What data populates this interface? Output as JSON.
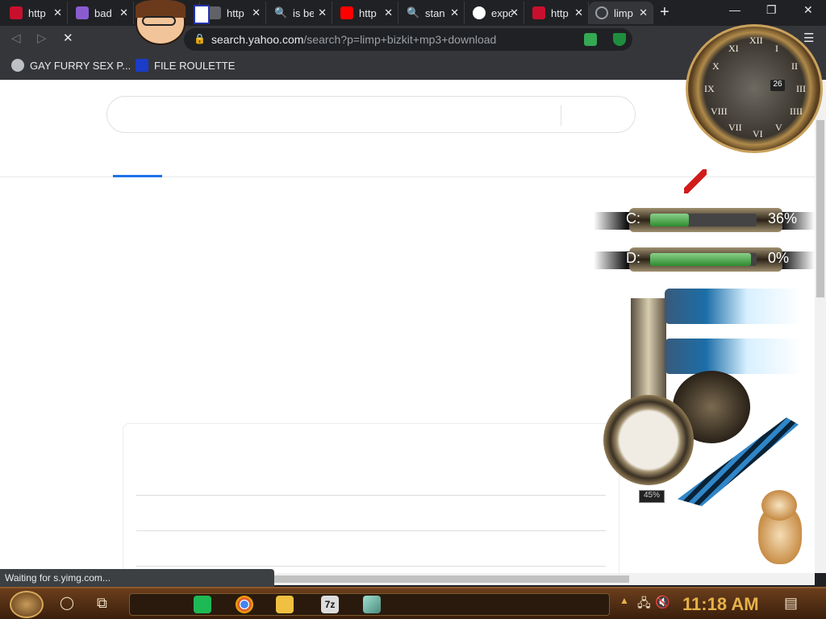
{
  "tabs": [
    {
      "label": "http",
      "icon": "ask-icon",
      "color": "#c8102e"
    },
    {
      "label": "bad",
      "icon": "paintbrush-icon",
      "color": "#8a5cd0"
    },
    {
      "label": "",
      "icon": "ask-icon",
      "color": "#c8102e"
    },
    {
      "label": "http",
      "icon": "generic-icon",
      "color": "#5f6368"
    },
    {
      "label": "is be",
      "icon": "search-icon",
      "color": "#4a90e2"
    },
    {
      "label": "http",
      "icon": "youtube-icon",
      "color": "#ff0000"
    },
    {
      "label": "stan",
      "icon": "search-icon",
      "color": "#4a90e2"
    },
    {
      "label": "expo",
      "icon": "google-icon",
      "color": "#ffffff"
    },
    {
      "label": "http",
      "icon": "ask-icon",
      "color": "#c8102e"
    },
    {
      "label": "limp",
      "icon": "loading-icon",
      "color": "#9aa0a6"
    }
  ],
  "address_bar": {
    "domain": "search.yahoo.com",
    "path": "/search?p=limp+bizkit+mp3+download"
  },
  "bookmarks": [
    {
      "label": "GAY FURRY SEX P...",
      "icon": "globe-icon"
    },
    {
      "label": "FILE ROULETTE",
      "icon": "mf-icon"
    }
  ],
  "status_text": "Waiting for s.yimg.com...",
  "drives": [
    {
      "label": "C:",
      "percent_text": "36%",
      "fill": 0.36
    },
    {
      "label": "D:",
      "percent_text": "0%",
      "fill": 0.95
    }
  ],
  "cpu_gauge": {
    "value_text": "45%"
  },
  "clock_widget": {
    "date": "26",
    "numerals": [
      "XII",
      "I",
      "II",
      "III",
      "IIII",
      "V",
      "VI",
      "VII",
      "VIII",
      "IX",
      "X",
      "XI"
    ]
  },
  "taskbar": {
    "time": "11:18 AM"
  }
}
